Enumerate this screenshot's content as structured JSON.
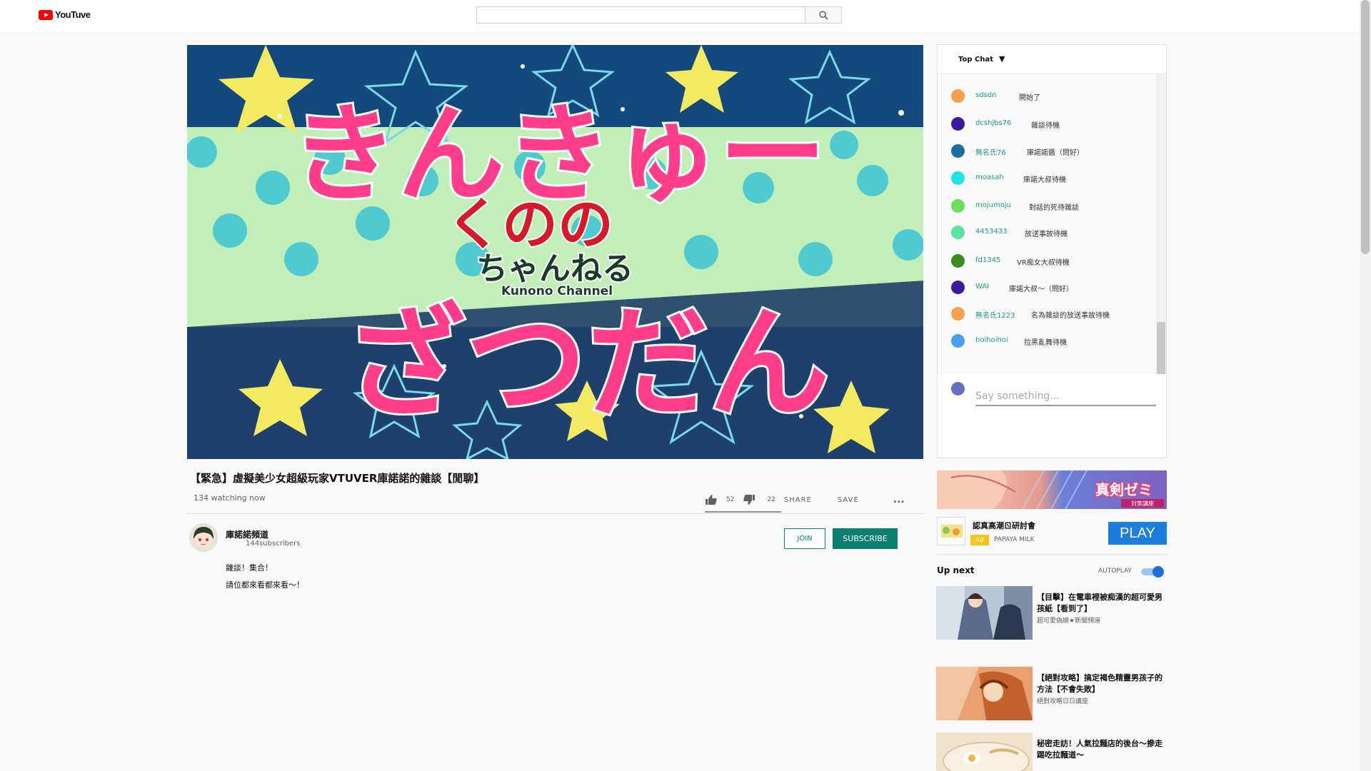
{
  "header": {
    "logo_text": "YouTuve",
    "search": {
      "value": "",
      "placeholder": ""
    }
  },
  "video": {
    "title": "【緊急】虛擬美少女超級玩家VTUVER庫諾諾的雜談【閒聊】",
    "watching": "134 watching now",
    "likes": "52",
    "dislikes": "22",
    "share_label": "SHARE",
    "save_label": "SAVE",
    "more_label": "...",
    "thumbnail": {
      "logo_text": "くのの",
      "logo_sub": "ちゃんねる",
      "logo_en": "Kunono Channel",
      "top_text": "きんきゅー",
      "bottom_text": "ざつだん"
    }
  },
  "channel": {
    "name": "庫諾諾頻道",
    "subscribers": "144subscribers",
    "join_label": "JOIN",
    "subscribe_label": "SUBSCRIBE",
    "description": [
      "雜談！集合！",
      "請位都來看都來看～！"
    ]
  },
  "chat": {
    "header_label": "Top Chat",
    "caret": "▼",
    "messages": [
      {
        "user": "sdsdn",
        "text": "開始了",
        "color": "#f4a14a"
      },
      {
        "user": "dcshjbs76",
        "text": "雜談待機",
        "color": "#3a1a9e"
      },
      {
        "user": "無名氏76",
        "text": "庫諾諾醬（問好）",
        "color": "#1a6fa0"
      },
      {
        "user": "moasah",
        "text": "庫諾大叔待機",
        "color": "#1ee3ea"
      },
      {
        "user": "mojumoju",
        "text": "對話的死待雜談",
        "color": "#6de05a"
      },
      {
        "user": "4453433",
        "text": "放送事故待機",
        "color": "#5ae3a0"
      },
      {
        "user": "fd1345",
        "text": "VR痴女大叔待機",
        "color": "#3f8a1a"
      },
      {
        "user": "WAI",
        "text": "庫諾大叔～（問好）",
        "color": "#3a1a9e"
      },
      {
        "user": "無名氏1223",
        "text": "名為雜談的放送事故待機",
        "color": "#f4a14a"
      },
      {
        "user": "hoihoihoi",
        "text": "拉黑亂舞待機",
        "color": "#4a9ef0"
      }
    ],
    "input_placeholder": "Say something..."
  },
  "ad": {
    "banner_text": "真剣ゼミ",
    "banner_sub": "対策講座",
    "title": "認真高潮ㄖ研討會",
    "badge": "Ad",
    "brand": "PAPAYA MILK",
    "play_label": "PLAY"
  },
  "upnext": {
    "label": "Up next",
    "autoplay_label": "AUTOPLAY",
    "autoplay_on": true,
    "items": [
      {
        "title": "【目擊】在電車裡被痴漢的超可愛男孩紙【看到了】",
        "channel": "超可愛偽娘★新聞頻道"
      },
      {
        "title": "【絕對攻略】搞定褐色精靈男孩子的方法【不會失敗】",
        "channel": "絕對攻略ㄖㄖ講座"
      },
      {
        "title": "秘密走訪！人氣拉麵店的後台～摻走踢吃拉麵道～",
        "channel": ""
      }
    ]
  },
  "colors": {
    "accent_teal": "#0b7f70",
    "play_blue": "#1e7ee0",
    "chat_user": "#1a9a8a"
  }
}
